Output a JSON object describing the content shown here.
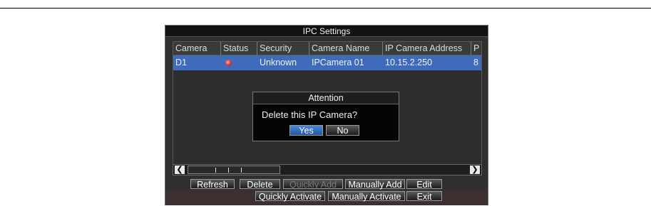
{
  "window": {
    "title": "IPC Settings"
  },
  "table": {
    "columns": [
      "Camera",
      "Status",
      "Security",
      "Camera Name",
      "IP Camera Address",
      "P"
    ],
    "rows": [
      {
        "camera": "D1",
        "status": "offline",
        "security": "Unknown",
        "camera_name": "IPCamera 01",
        "ip_address": "10.15.2.250",
        "port_partial": "8"
      }
    ]
  },
  "buttons": {
    "refresh": "Refresh",
    "delete": "Delete",
    "quickly_add": "Quickly Add",
    "manually_add": "Manually Add",
    "edit": "Edit",
    "quickly_activate": "Quickly Activate",
    "manually_activate": "Manually Activate",
    "exit": "Exit"
  },
  "dialog": {
    "title": "Attention",
    "message": "Delete this IP Camera?",
    "yes": "Yes",
    "no": "No"
  },
  "colors": {
    "selected_row": "#3f6cba",
    "status_offline": "#e03030",
    "accent_button": "#2f6fc4"
  },
  "icons": {
    "scroll_left": "chevron-left-icon",
    "scroll_right": "chevron-right-icon",
    "status": "status-offline-icon"
  }
}
